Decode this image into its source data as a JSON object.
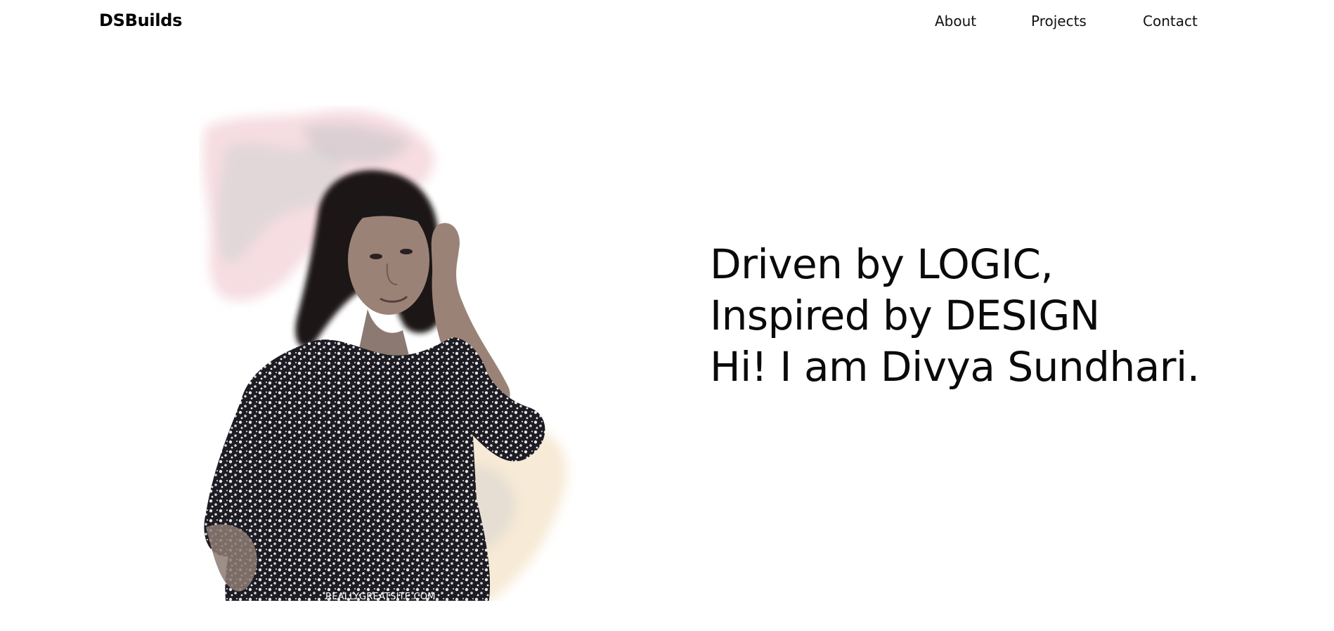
{
  "header": {
    "brand": "DSBuilds",
    "nav": {
      "about": "About",
      "projects": "Projects",
      "contact": "Contact"
    }
  },
  "hero": {
    "lines": [
      "Driven by LOGIC,",
      "Inspired by DESIGN",
      "Hi! I am Divya Sundhari."
    ],
    "image": {
      "watermark": "REALLYGREATSITE.COM",
      "splash_colors": [
        "#f6dde2",
        "#f7ead6",
        "#bdbdbd"
      ]
    }
  }
}
